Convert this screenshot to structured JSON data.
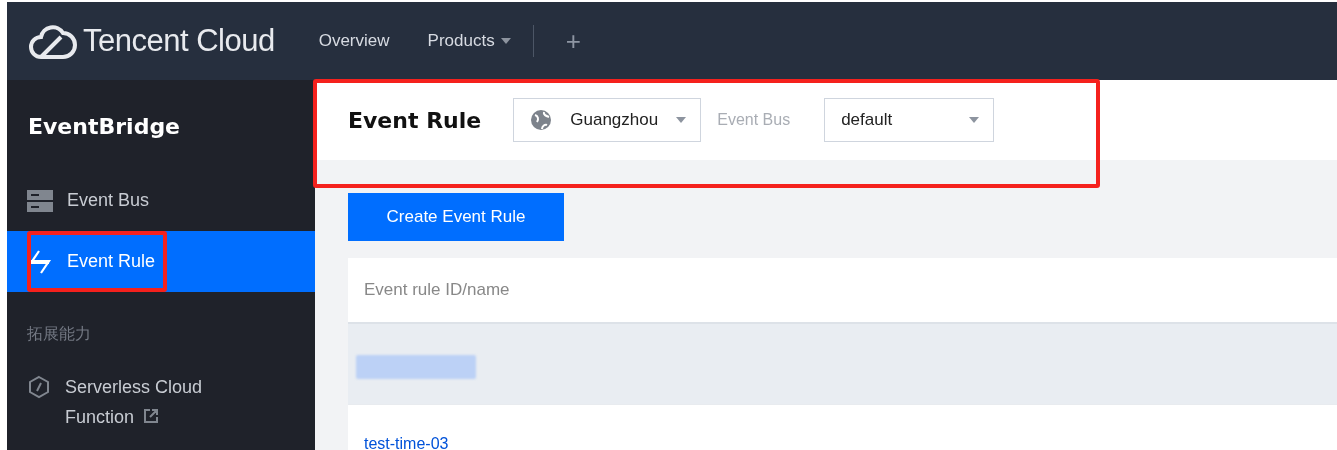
{
  "topbar": {
    "logo": "Tencent Cloud",
    "nav": [
      {
        "label": "Overview",
        "kind": "link"
      },
      {
        "label": "Products",
        "kind": "dropdown"
      }
    ],
    "add_button": "+"
  },
  "sidebar": {
    "title": "EventBridge",
    "items": [
      {
        "label": "Event Bus",
        "selected": false,
        "highlighted": false
      },
      {
        "label": "Event Rule",
        "selected": true,
        "highlighted": true
      }
    ],
    "section": "拓展能力",
    "links": [
      {
        "label": "Serverless Cloud Function",
        "external": true
      }
    ]
  },
  "header": {
    "title": "Event Rule",
    "highlighted": true,
    "region": "Guangzhou",
    "bus_label": "Event Bus",
    "bus": "default"
  },
  "create_button": "Create Event Rule",
  "table": {
    "columns": [
      "Event rule ID/name"
    ],
    "rows": [
      {
        "kind": "redacted"
      },
      {
        "kind": "link",
        "name": "test-time-03"
      }
    ]
  }
}
